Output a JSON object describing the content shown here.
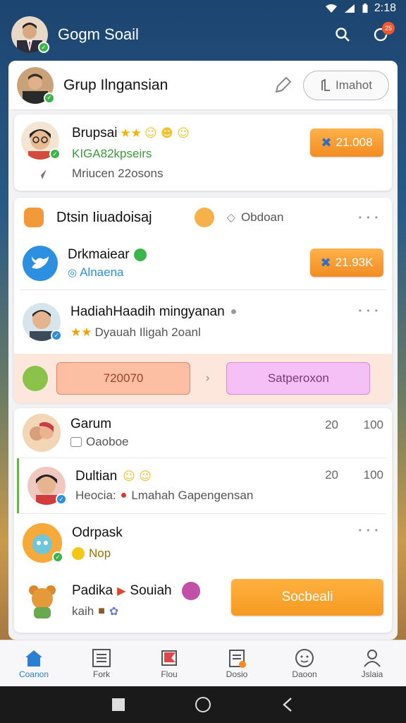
{
  "status": {
    "time": "2:18"
  },
  "app": {
    "title": "Gogm Soail",
    "notif_count": "25"
  },
  "group": {
    "title": "Grup Ilngansian",
    "button_label": "Imahot"
  },
  "card1": {
    "name": "Brupsai",
    "subline": "KIGA82kpseirs",
    "meta": "Mriucen 22osons",
    "pill": "21.008"
  },
  "card2": {
    "header_title": "Dtsin Iiuadoisaj",
    "header_right": "Obdoan",
    "item1_name": "Drkmaiear",
    "item1_sub": "Alnaena",
    "item1_pill": "21.93K",
    "item2_name": "HadiahHaadih mingyanan",
    "item2_sub": "Dyauah Iligah 2oanl",
    "left_button": "720070",
    "right_button": "Satperoxon"
  },
  "list": [
    {
      "name": "Garum",
      "sub": "Oaoboe",
      "num1": "20",
      "num2": "100"
    },
    {
      "name": "Dultian",
      "sub_prefix": "Heocia:",
      "sub": "Lmahah Gapengensan",
      "num1": "20",
      "num2": "100"
    },
    {
      "name": "Odrpask",
      "sub": "Nop"
    },
    {
      "name": "Padika",
      "name2": "Souiah",
      "sub": "kaih",
      "button": "Socbeali"
    }
  ],
  "nav": [
    {
      "label": "Coanon",
      "icon": "home-icon"
    },
    {
      "label": "Fork",
      "icon": "list-icon"
    },
    {
      "label": "Flou",
      "icon": "flag-icon"
    },
    {
      "label": "Dosio",
      "icon": "clipboard-icon"
    },
    {
      "label": "Daoon",
      "icon": "smiley-icon"
    },
    {
      "label": "Jslaia",
      "icon": "person-icon"
    }
  ],
  "colors": {
    "accent": "#f28c22",
    "active": "#2a7fd0",
    "pink": "#f5c0f5",
    "salmon": "#fcc3a8"
  }
}
